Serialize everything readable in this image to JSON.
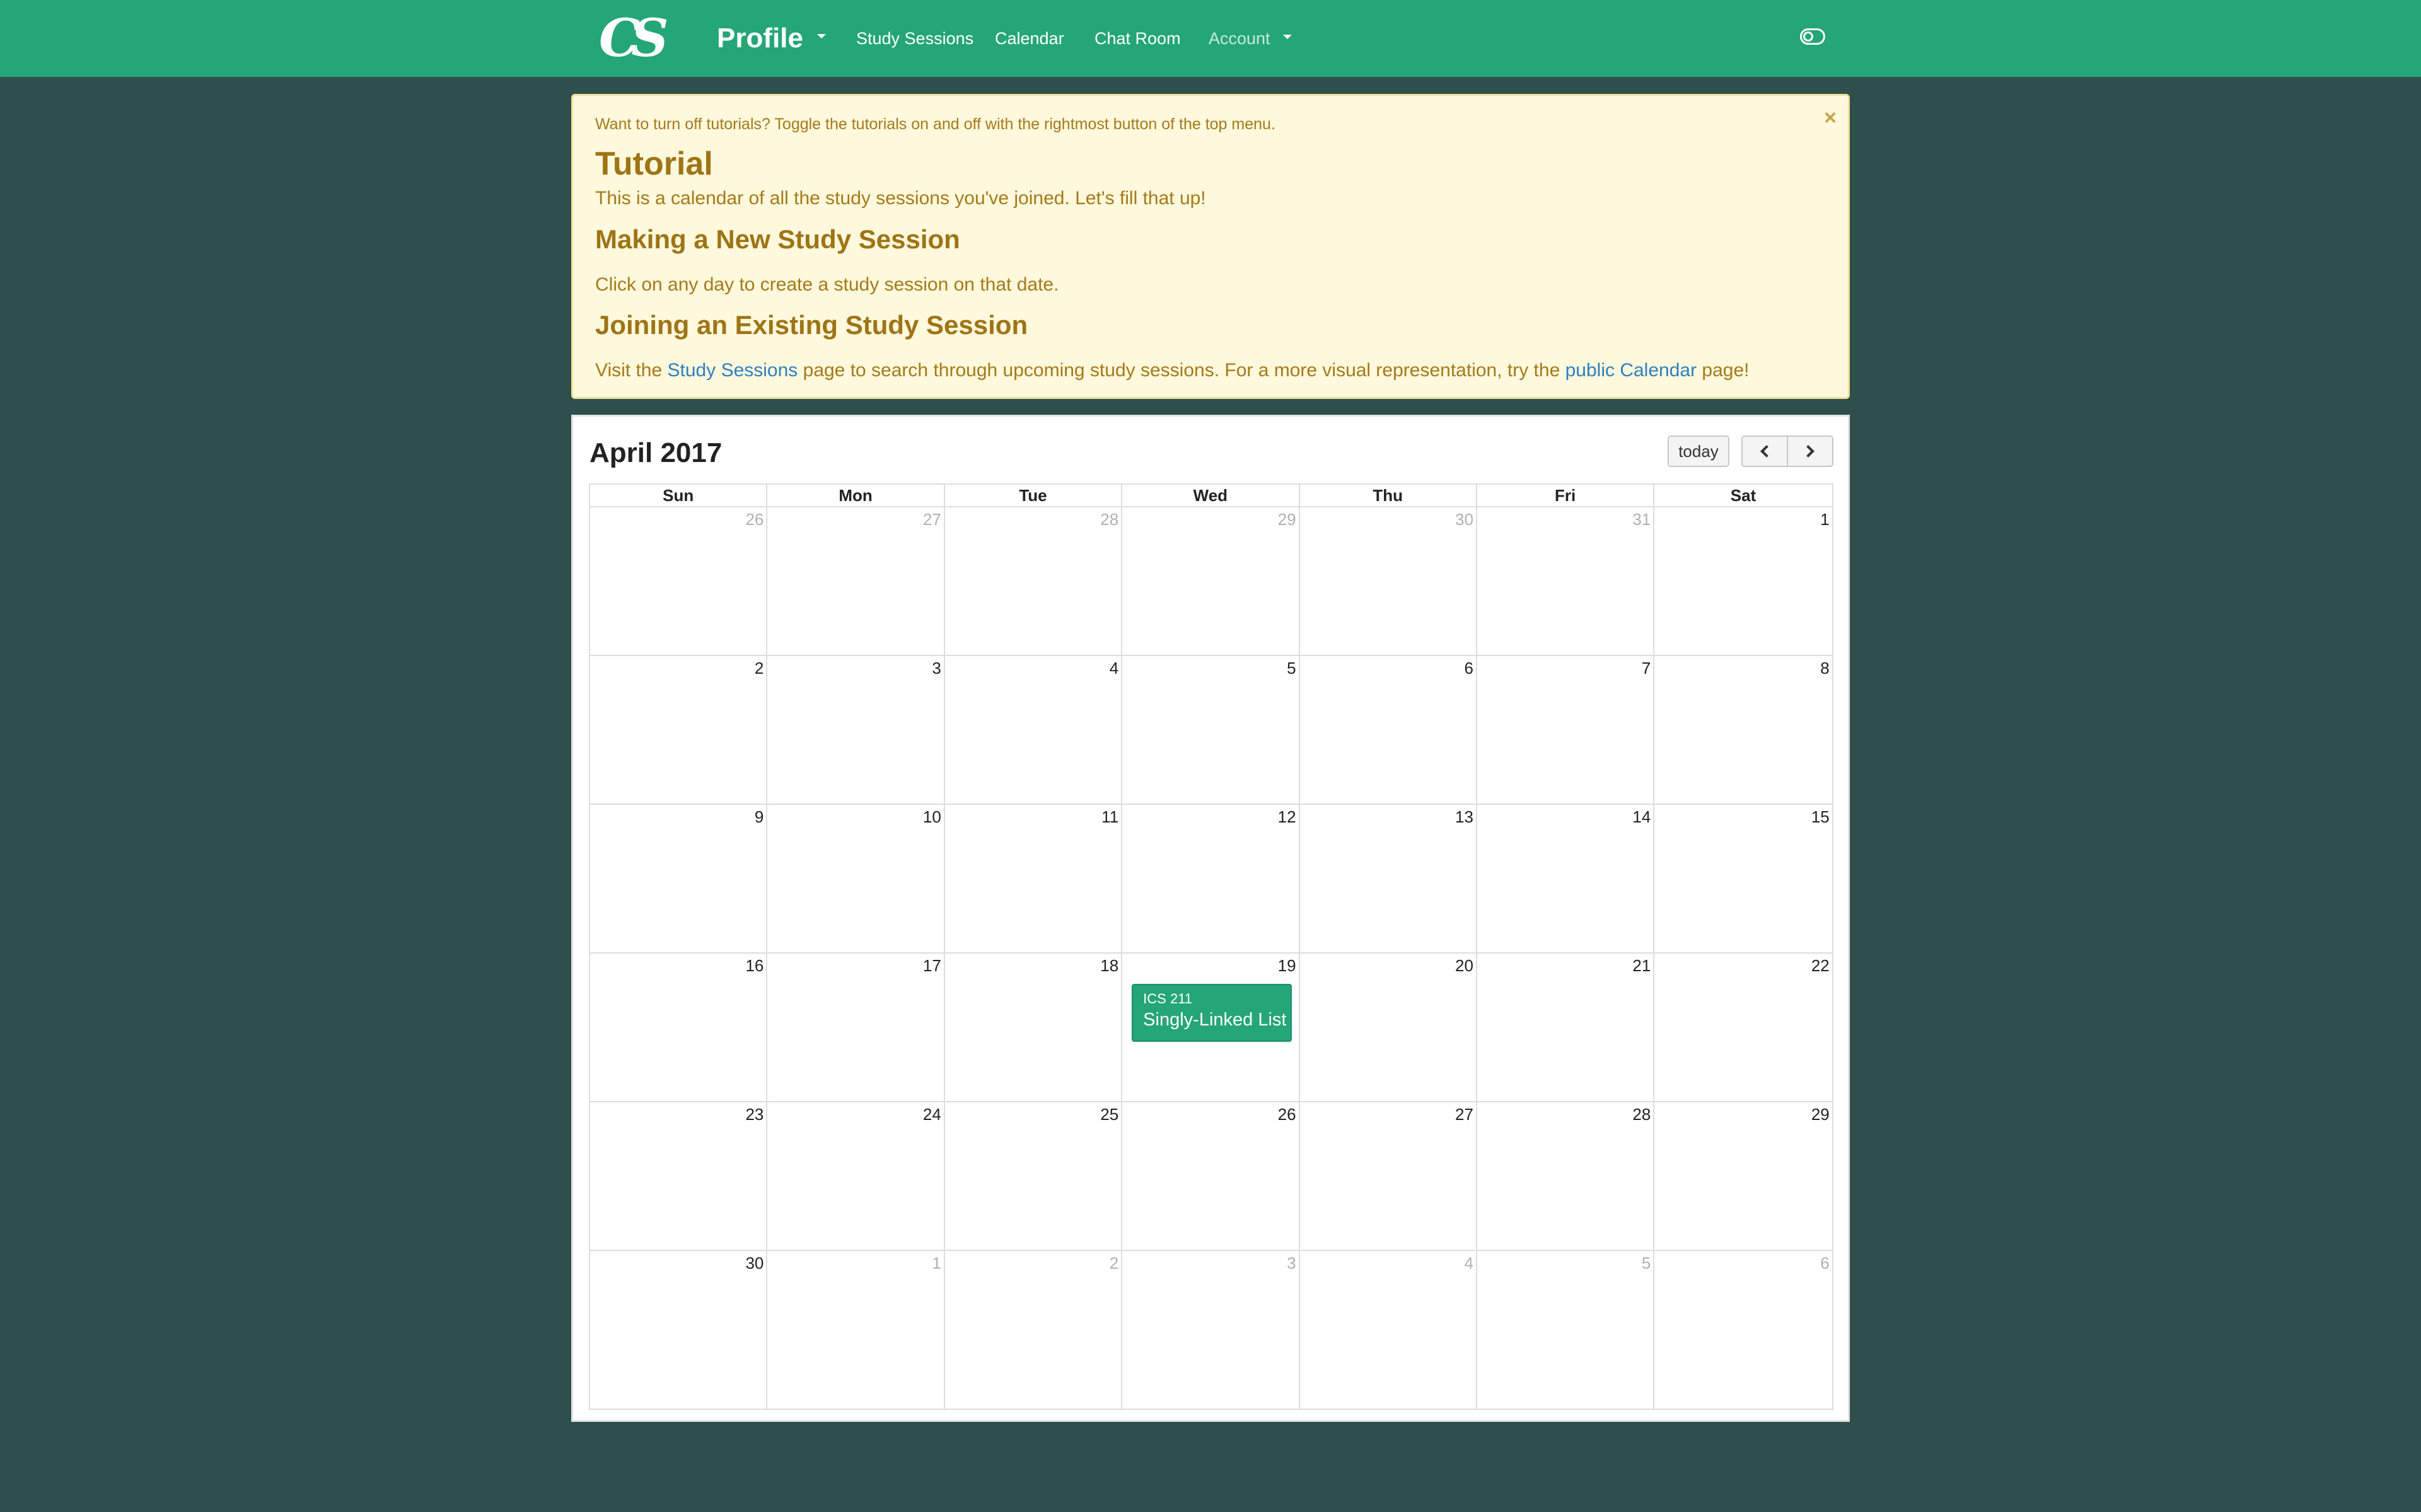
{
  "navbar": {
    "logo_text": "CS",
    "brand": "Profile",
    "links": [
      {
        "label": "Study Sessions"
      },
      {
        "label": "Calendar"
      },
      {
        "label": "Chat Room"
      }
    ],
    "account_label": "Account",
    "toggle_icon": "toggle-icon",
    "color": "#24a677"
  },
  "tutorial": {
    "note": "Want to turn off tutorials? Toggle the tutorials on and off with the rightmost button of the top menu.",
    "close_symbol": "×",
    "heading": "Tutorial",
    "intro": "This is a calendar of all the study sessions you've joined. Let's fill that up!",
    "new_heading": "Making a New Study Session",
    "new_text": "Click on any day to create a study session on that date.",
    "join_heading": "Joining an Existing Study Session",
    "join_text_1": "Visit the ",
    "join_link_1": "Study Sessions",
    "join_text_2": " page to search through upcoming study sessions. For a more visual representation, try the ",
    "join_link_2": "public Calendar",
    "join_text_3": " page!"
  },
  "calendar": {
    "title": "April 2017",
    "today_label": "today",
    "prev_icon": "chevron-left-icon",
    "next_icon": "chevron-right-icon",
    "weekdays": [
      "Sun",
      "Mon",
      "Tue",
      "Wed",
      "Thu",
      "Fri",
      "Sat"
    ],
    "weeks": [
      [
        {
          "d": "26",
          "other": true
        },
        {
          "d": "27",
          "other": true
        },
        {
          "d": "28",
          "other": true
        },
        {
          "d": "29",
          "other": true
        },
        {
          "d": "30",
          "other": true
        },
        {
          "d": "31",
          "other": true
        },
        {
          "d": "1"
        }
      ],
      [
        {
          "d": "2"
        },
        {
          "d": "3"
        },
        {
          "d": "4"
        },
        {
          "d": "5"
        },
        {
          "d": "6"
        },
        {
          "d": "7"
        },
        {
          "d": "8"
        }
      ],
      [
        {
          "d": "9"
        },
        {
          "d": "10"
        },
        {
          "d": "11"
        },
        {
          "d": "12"
        },
        {
          "d": "13"
        },
        {
          "d": "14"
        },
        {
          "d": "15"
        }
      ],
      [
        {
          "d": "16"
        },
        {
          "d": "17"
        },
        {
          "d": "18"
        },
        {
          "d": "19",
          "event": {
            "time": "ICS 211",
            "title": "Singly-Linked List"
          }
        },
        {
          "d": "20"
        },
        {
          "d": "21"
        },
        {
          "d": "22"
        }
      ],
      [
        {
          "d": "23"
        },
        {
          "d": "24"
        },
        {
          "d": "25"
        },
        {
          "d": "26"
        },
        {
          "d": "27"
        },
        {
          "d": "28"
        },
        {
          "d": "29"
        }
      ],
      [
        {
          "d": "30"
        },
        {
          "d": "1",
          "other": true
        },
        {
          "d": "2",
          "other": true
        },
        {
          "d": "3",
          "other": true
        },
        {
          "d": "4",
          "other": true
        },
        {
          "d": "5",
          "other": true
        },
        {
          "d": "6",
          "other": true
        }
      ]
    ]
  }
}
